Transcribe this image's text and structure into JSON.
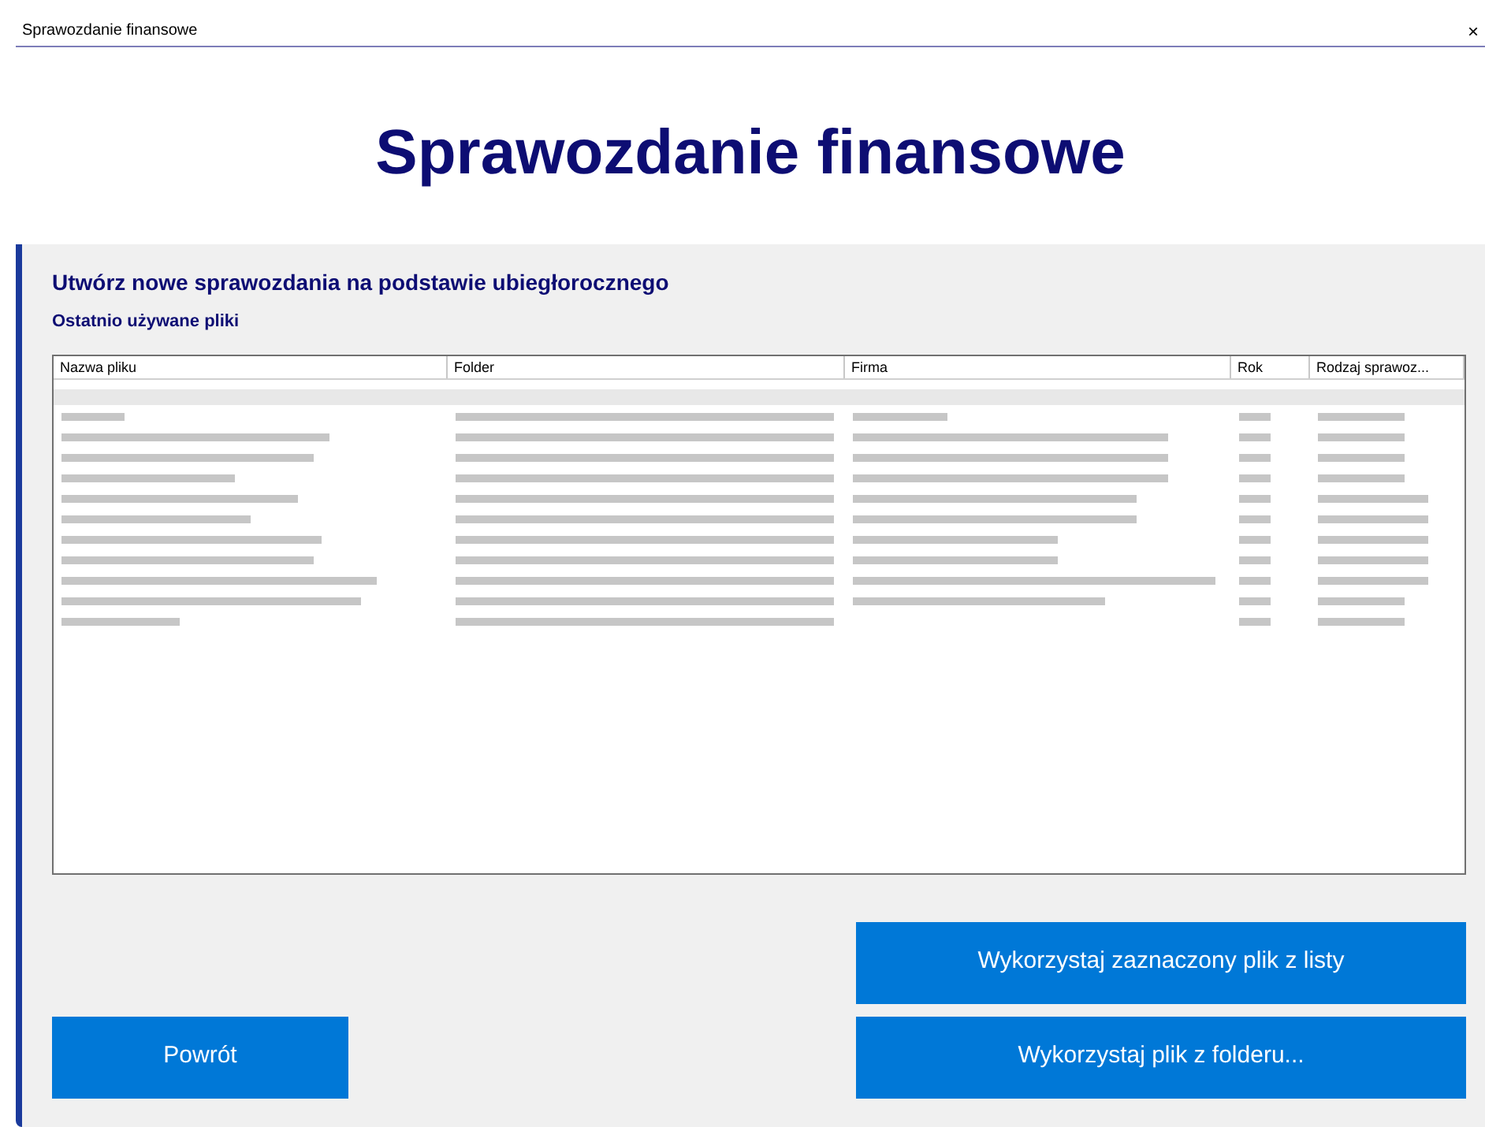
{
  "window": {
    "title": "Sprawozdanie finansowe",
    "close": "×"
  },
  "header": {
    "title": "Sprawozdanie finansowe"
  },
  "section": {
    "title": "Utwórz nowe sprawozdania na podstawie ubiegłorocznego",
    "subtitle": "Ostatnio używane pliki"
  },
  "table": {
    "columns": [
      "Nazwa pliku",
      "Folder",
      "Firma",
      "Rok",
      "Rodzaj sprawoz..."
    ]
  },
  "buttons": {
    "use_selected": "Wykorzystaj zaznaczony plik z listy",
    "back": "Powrót",
    "use_folder": "Wykorzystaj plik z folderu..."
  }
}
